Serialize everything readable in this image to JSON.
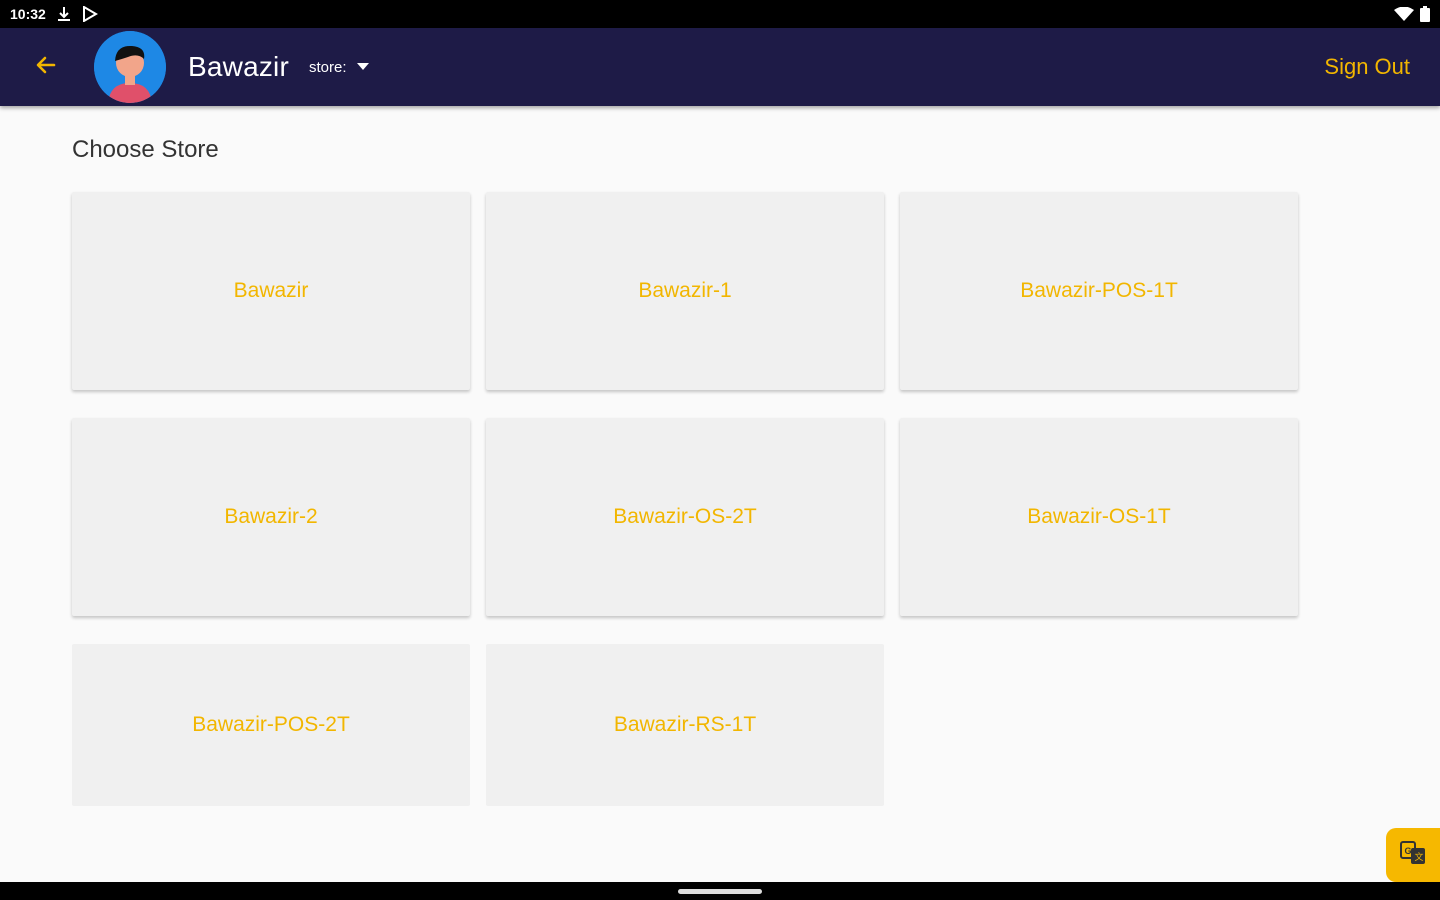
{
  "status_bar": {
    "time": "10:32",
    "left_icons": [
      "download-icon",
      "play-store-icon"
    ],
    "right_icons": [
      "wifi-icon",
      "battery-icon"
    ]
  },
  "app_bar": {
    "user_name": "Bawazir",
    "store_label": "store:",
    "sign_out_label": "Sign Out",
    "accent_color": "#f2b600",
    "background_color": "#1e1b47"
  },
  "page": {
    "heading": "Choose Store"
  },
  "stores": [
    {
      "label": "Bawazir"
    },
    {
      "label": "Bawazir-1"
    },
    {
      "label": "Bawazir-POS-1T"
    },
    {
      "label": "Bawazir-2"
    },
    {
      "label": "Bawazir-OS-2T"
    },
    {
      "label": "Bawazir-OS-1T"
    },
    {
      "label": "Bawazir-POS-2T"
    },
    {
      "label": "Bawazir-RS-1T"
    }
  ],
  "fab": {
    "icon": "translate-icon"
  }
}
